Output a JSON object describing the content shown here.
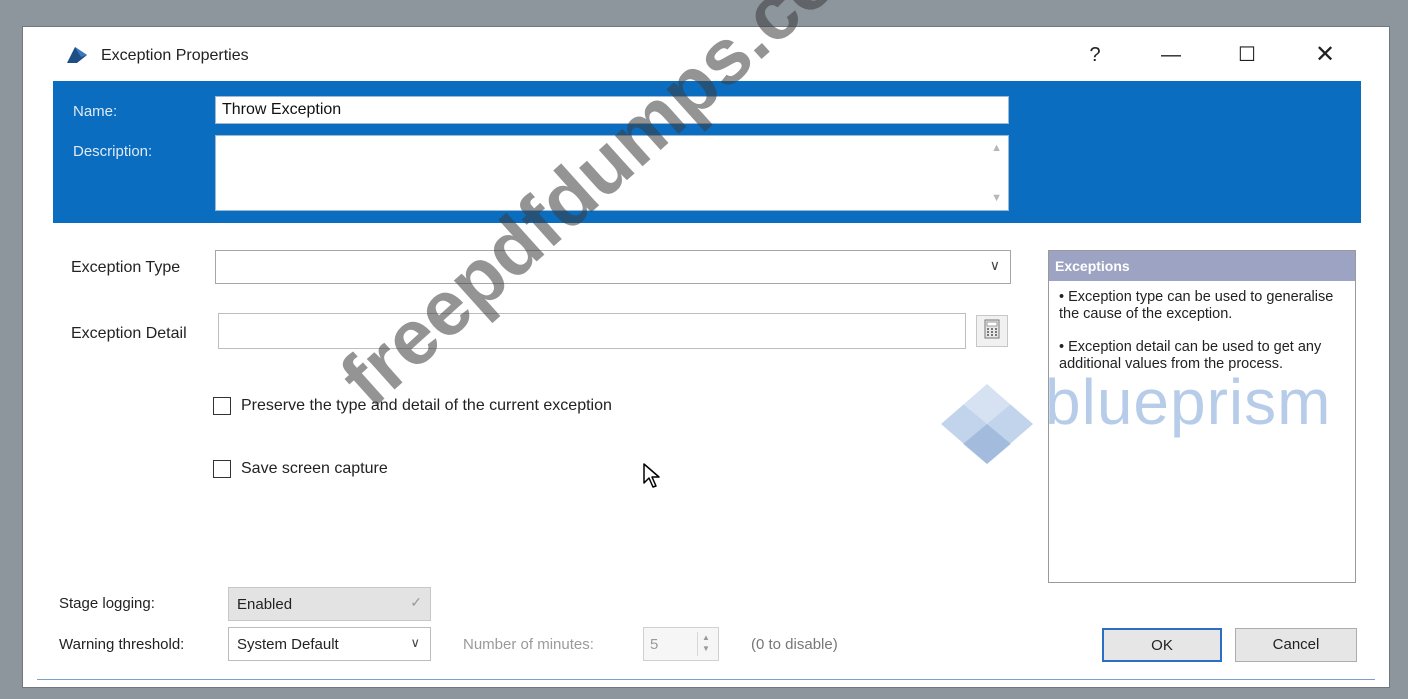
{
  "window": {
    "title": "Exception Properties",
    "help_label": "?",
    "minimize_label": "—",
    "maximize_label": "☐",
    "close_label": "✕"
  },
  "header": {
    "name_label": "Name:",
    "name_value": "Throw Exception",
    "description_label": "Description:",
    "description_value": ""
  },
  "form": {
    "exception_type_label": "Exception Type",
    "exception_type_value": "",
    "exception_detail_label": "Exception Detail",
    "exception_detail_value": "",
    "preserve_label": "Preserve the type and detail of the current exception",
    "preserve_checked": false,
    "screen_capture_label": "Save screen capture",
    "screen_capture_checked": false
  },
  "help_panel": {
    "title": "Exceptions",
    "para1": "• Exception type can be used to generalise the cause of the exception.",
    "para2": "• Exception detail can be used to get any additional values from the process."
  },
  "watermarks": {
    "brand_text": "blueprism",
    "site_text": "freepdfdumps.com"
  },
  "bottom": {
    "stage_logging_label": "Stage logging:",
    "stage_logging_value": "Enabled",
    "warning_threshold_label": "Warning threshold:",
    "warning_threshold_value": "System Default",
    "minutes_label": "Number of minutes:",
    "minutes_value": "5",
    "disable_hint": "(0 to disable)",
    "ok_label": "OK",
    "cancel_label": "Cancel"
  },
  "colors": {
    "header_blue": "#0a6dc0",
    "help_header": "#9da3c3",
    "ok_border": "#2a6fc4"
  }
}
